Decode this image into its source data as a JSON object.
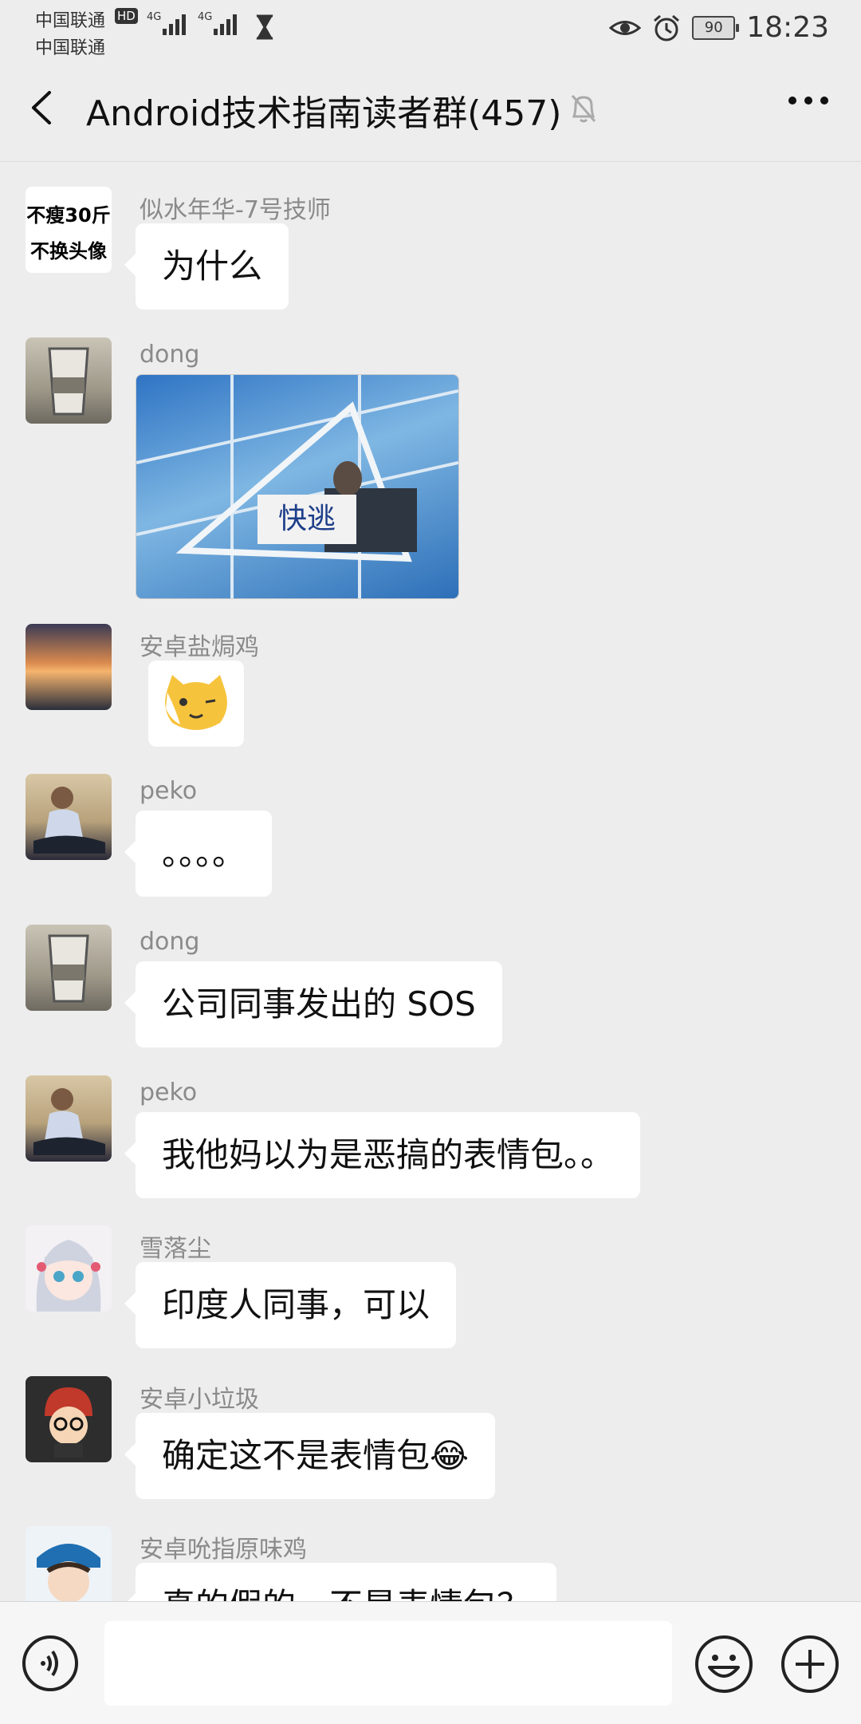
{
  "status_bar": {
    "carrier_1": "中国联通",
    "carrier_2": "中国联通",
    "hd": "HD",
    "network_1": "4G",
    "network_2": "4G",
    "battery": "90",
    "time": "18:23",
    "icons": [
      "hourglass-icon",
      "eye-icon",
      "alarm-icon",
      "battery-icon"
    ]
  },
  "header": {
    "title": "Android技术指南读者群(457)",
    "icons": [
      "back-arrow-icon",
      "mute-bell-icon",
      "more-dots-icon"
    ]
  },
  "messages": [
    {
      "sender": "似水年华-7号技师",
      "type": "text",
      "text": "为什么",
      "avatar_text": [
        "不瘦30斤",
        "不换头像"
      ]
    },
    {
      "sender": "dong",
      "type": "image",
      "image_text": "快逃"
    },
    {
      "sender": "安卓盐焗鸡",
      "type": "sticker",
      "sticker": "cat-face-emoji"
    },
    {
      "sender": "peko",
      "type": "text",
      "text": "。。。。"
    },
    {
      "sender": "dong",
      "type": "text",
      "text": "公司同事发出的 SOS"
    },
    {
      "sender": "peko",
      "type": "text",
      "text": "我他妈以为是恶搞的表情包。。"
    },
    {
      "sender": "雪落尘",
      "type": "text",
      "text": "印度人同事，可以"
    },
    {
      "sender": "安卓小垃圾",
      "type": "text",
      "text": "确定这不是表情包😂"
    },
    {
      "sender": "安卓吮指原味鸡",
      "type": "text",
      "text": "真的假的，不是表情包？"
    }
  ],
  "input_bar": {
    "placeholder": "",
    "icons": [
      "voice-icon",
      "emoji-icon",
      "plus-icon"
    ]
  },
  "colors": {
    "background": "#ededed",
    "bubble": "#ffffff",
    "sender_name": "#8a8a8a"
  }
}
